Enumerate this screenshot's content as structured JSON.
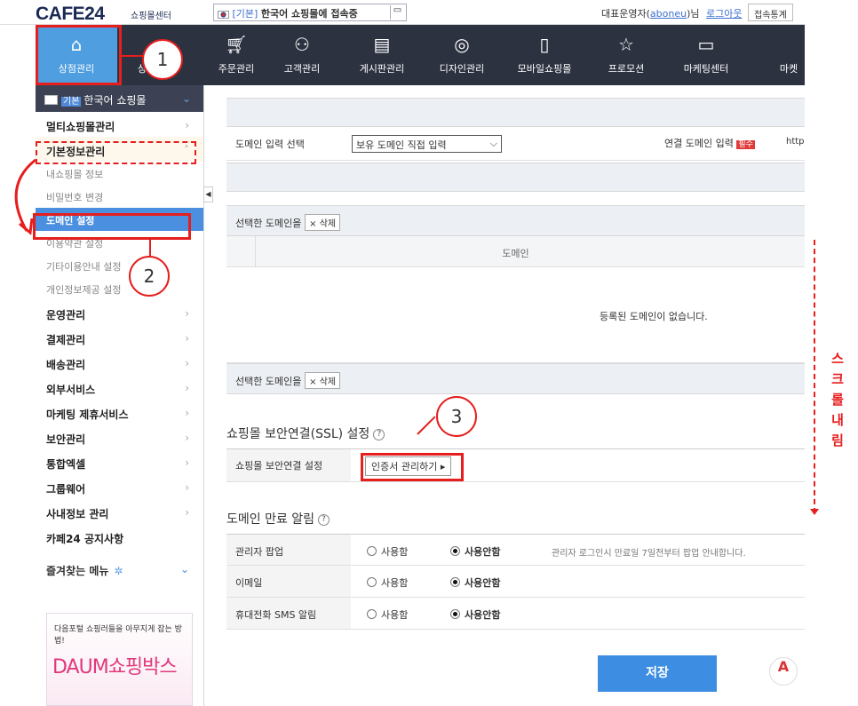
{
  "topbar": {
    "logo": "CAFE24",
    "logo_sub": "쇼핑몰센터",
    "shop_lang": "[기본]",
    "shop_text": "한국어 쇼핑몰에 접속중",
    "admin_prefix": "대표운영자(",
    "admin_id": "aboneu",
    "admin_suffix": ")님",
    "logout": "로그아웃",
    "stats": "접속통계"
  },
  "gnb": [
    "상점관리",
    "상",
    "주문관리",
    "고객관리",
    "게시판관리",
    "디자인관리",
    "모바일쇼핑몰",
    "프로모션",
    "마케팅센터",
    "마켓"
  ],
  "sidebar": {
    "shop_badge": "기본",
    "shop_name": "한국어 쇼핑몰",
    "cat_multi": "멀티쇼핑몰관리",
    "cat_basic": "기본정보관리",
    "subs": [
      "내쇼핑몰 정보",
      "비밀번호 변경",
      "도메인 설정",
      "이용약관 설정",
      "기타이용안내 설정",
      "개인정보제공 설정"
    ],
    "cats": [
      "운영관리",
      "결제관리",
      "배송관리",
      "외부서비스",
      "마케팅 제휴서비스",
      "보안관리",
      "통합엑셀",
      "그룹웨어",
      "사내정보 관리",
      "카페24 공지사항"
    ],
    "fav": "즐겨찾는 메뉴",
    "banner_top": "다음포털 쇼핑러들을 아무지게 잡는 방법!",
    "banner_main": "DAUM쇼핑박스"
  },
  "domain": {
    "input_label": "도메인 입력 선택",
    "input_select": "보유 도메인 직접 입력",
    "link_label": "연결 도메인 입력",
    "required": "필수",
    "link_value": "http",
    "selected_label": "선택한 도메인을",
    "delete": "× 삭제",
    "col_domain": "도메인",
    "empty": "등록된 도메인이 없습니다."
  },
  "ssl": {
    "title": "쇼핑몰 보안연결(SSL) 설정",
    "row_label": "쇼핑몰 보안연결 설정",
    "button": "인증서 관리하기 ▸"
  },
  "expire": {
    "title": "도메인 만료 알림",
    "rows": [
      {
        "label": "관리자 팝업",
        "on": "사용함",
        "off": "사용안함",
        "note": "관리자 로그인시 만료일 7일전부터 팝업 안내합니다."
      },
      {
        "label": "이메일",
        "on": "사용함",
        "off": "사용안함",
        "note": ""
      },
      {
        "label": "휴대전화 SMS 알림",
        "on": "사용함",
        "off": "사용안함",
        "note": ""
      }
    ]
  },
  "save": "저장",
  "help": "?",
  "annotations": {
    "n1": "1",
    "n2": "2",
    "n3": "3",
    "scroll": "스크롤 내림"
  },
  "colors": {
    "annotation": "#e61e1e",
    "gnb_bg": "#2d3240",
    "gnb_active": "#4e9ee0",
    "sub_active": "#4b8fe0",
    "save": "#3d8de3"
  }
}
